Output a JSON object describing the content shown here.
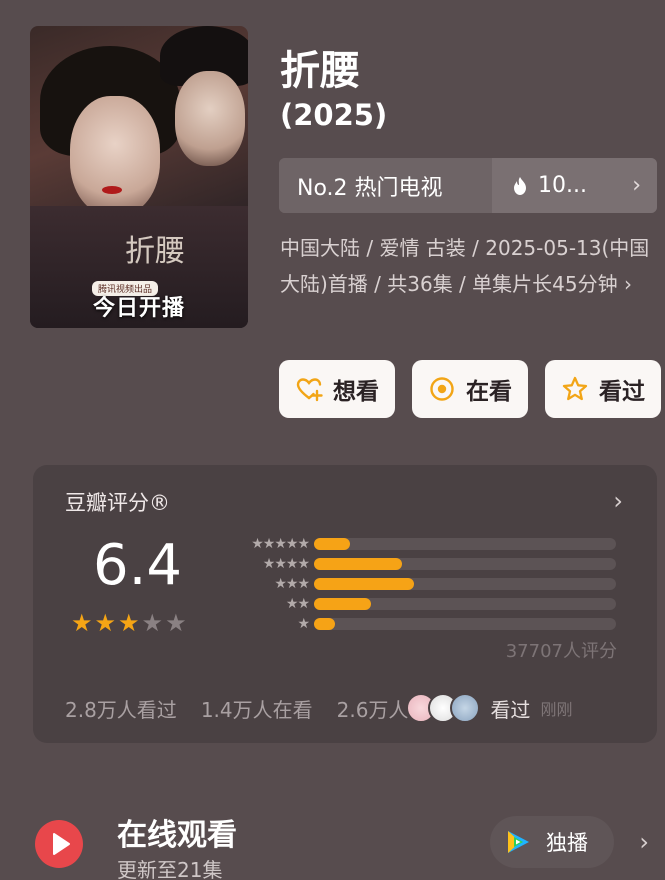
{
  "poster": {
    "calligraphy": "折腰",
    "studio_tag": "腾讯视频出品",
    "banner": "今日开播"
  },
  "header": {
    "title": "折腰",
    "year": "(2025)"
  },
  "rank": {
    "label": "No.2 热门电视",
    "heat": "10...",
    "icon": "fire-icon"
  },
  "meta": {
    "text": "中国大陆 / 爱情 古装 / 2025-05-13(中国大陆)首播 / 共36集 / 单集片长45分钟 ›"
  },
  "actions": [
    {
      "label": "想看",
      "icon": "heart-plus-icon"
    },
    {
      "label": "在看",
      "icon": "target-icon"
    },
    {
      "label": "看过",
      "icon": "star-outline-icon"
    }
  ],
  "rating": {
    "title": "豆瓣评分®",
    "score": "6.4",
    "stars_filled": 3,
    "stars_total": 5,
    "distribution": [
      {
        "stars": "★★★★★",
        "fraction": 0.12
      },
      {
        "stars": "★★★★",
        "fraction": 0.29
      },
      {
        "stars": "★★★",
        "fraction": 0.33
      },
      {
        "stars": "★★",
        "fraction": 0.19
      },
      {
        "stars": "★",
        "fraction": 0.07
      }
    ],
    "count": "37707人评分",
    "watched": "2.8万人看过",
    "watching": "1.4万人在看",
    "want": "2.6万人",
    "seen_label": "看过",
    "time": "刚刚",
    "colors": {
      "fill": "#f6a316",
      "track": "#5c5355"
    }
  },
  "online": {
    "title": "在线观看",
    "subtitle": "更新至21集",
    "exclusive": "独播"
  }
}
